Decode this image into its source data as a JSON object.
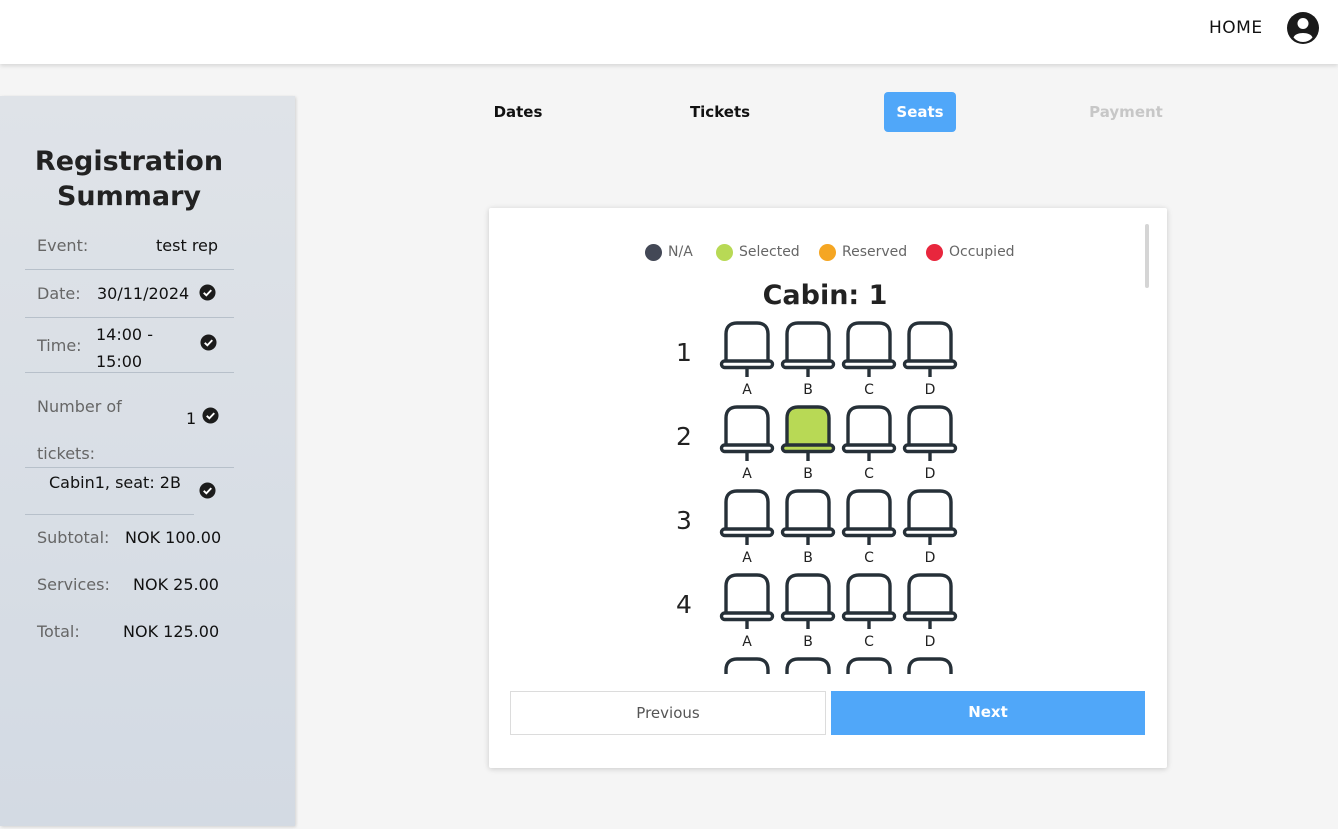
{
  "header": {
    "home_label": "HOME",
    "account_icon": "account-circle-icon"
  },
  "summary": {
    "title_line1": "Registration",
    "title_line2": "Summary",
    "event_label": "Event:",
    "event_value": "test rep",
    "date_label": "Date:",
    "date_value": "30/11/2024",
    "time_label": "Time:",
    "time_value_line1": "14:00 -",
    "time_value_line2": "15:00",
    "tickets_label_line1": "Number of",
    "tickets_label_line2": "tickets:",
    "tickets_value": "1",
    "seat_value": "Cabin1, seat: 2B",
    "subtotal_label": "Subtotal:",
    "subtotal_value": "NOK 100.00",
    "services_label": "Services:",
    "services_value": "NOK 25.00",
    "total_label": "Total:",
    "total_value": "NOK 125.00"
  },
  "steps": {
    "dates": "Dates",
    "tickets": "Tickets",
    "seats": "Seats",
    "payment": "Payment",
    "active": "Seats"
  },
  "legend": {
    "na": "N/A",
    "selected": "Selected",
    "reserved": "Reserved",
    "occupied": "Occupied",
    "colors": {
      "na": "#434856",
      "selected": "#b8d955",
      "reserved": "#f5a623",
      "occupied": "#e8263d"
    }
  },
  "cabin": {
    "title": "Cabin: 1",
    "columns": [
      "A",
      "B",
      "C",
      "D"
    ],
    "rows": [
      {
        "number": "1",
        "seats": [
          "available",
          "available",
          "available",
          "available"
        ]
      },
      {
        "number": "2",
        "seats": [
          "available",
          "selected",
          "available",
          "available"
        ]
      },
      {
        "number": "3",
        "seats": [
          "available",
          "available",
          "available",
          "available"
        ]
      },
      {
        "number": "4",
        "seats": [
          "available",
          "available",
          "available",
          "available"
        ]
      }
    ],
    "partial_row_visible": true
  },
  "buttons": {
    "previous": "Previous",
    "next": "Next"
  },
  "colors": {
    "accent": "#50a7f9",
    "seat_outline": "#263038",
    "selected_seat": "#b8d955"
  }
}
